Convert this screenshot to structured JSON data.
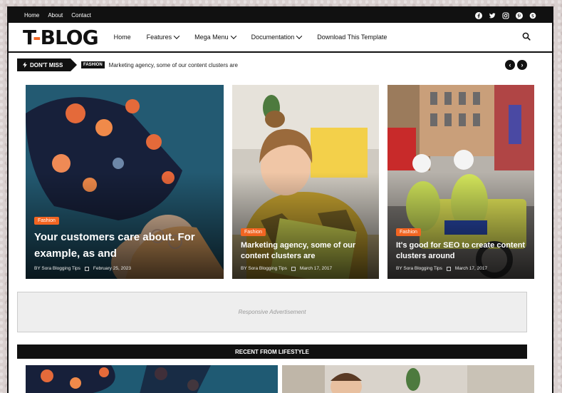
{
  "topbar": {
    "links": [
      "Home",
      "About",
      "Contact"
    ],
    "social_icons": [
      "facebook-icon",
      "twitter-icon",
      "instagram-icon",
      "pinterest-icon",
      "skype-icon"
    ]
  },
  "header": {
    "logo_left": "T",
    "logo_hyphen": "-",
    "logo_right": "BLOG",
    "nav": {
      "home": "Home",
      "features": "Features",
      "mega_menu": "Mega Menu",
      "documentation": "Documentation",
      "download": "Download This Template"
    }
  },
  "ticker": {
    "label": "DON'T MISS",
    "tag": "FASHION",
    "text": "Marketing agency, some of our content clusters are"
  },
  "featured": [
    {
      "tag": "Fashion",
      "title": "Your customers care about. For example, as and",
      "author": "BY Sora Blogging Tips",
      "date": "February 25, 2023"
    },
    {
      "tag": "Fashion",
      "title": "Marketing agency, some of our content clusters are",
      "author": "BY Sora Blogging Tips",
      "date": "March 17, 2017"
    },
    {
      "tag": "Fashion",
      "title": "It's good for SEO to create content clusters around",
      "author": "BY Sora Blogging Tips",
      "date": "March 17, 2017"
    }
  ],
  "ad": {
    "text": "Responsive Advertisement"
  },
  "recent": {
    "title": "RECENT FROM LIFESTYLE"
  },
  "colors": {
    "accent": "#f26522",
    "dark": "#111111"
  }
}
